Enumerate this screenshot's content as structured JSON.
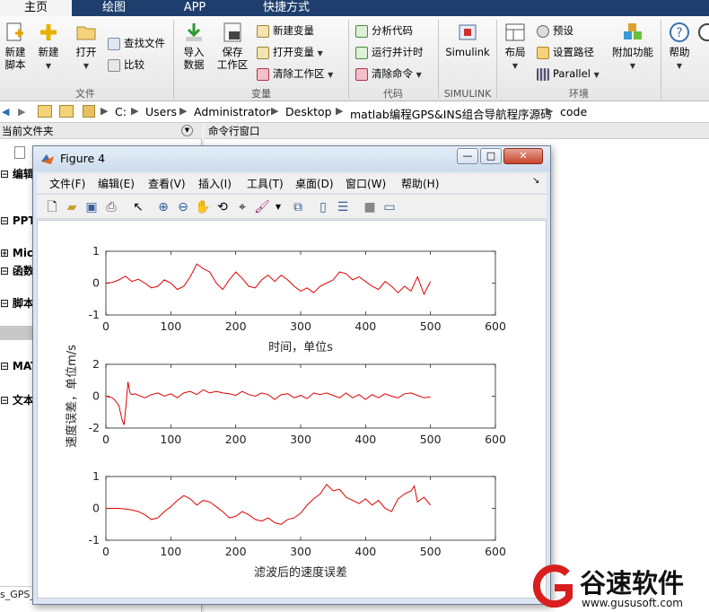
{
  "tabs": [
    "主页",
    "绘图",
    "APP",
    "快捷方式"
  ],
  "ribbon": {
    "file": {
      "new_script": "新建\n脚本",
      "new": "新建",
      "open": "打开",
      "find_files": "查找文件",
      "compare": "比较",
      "label": "文件"
    },
    "variable": {
      "import_data": "导入\n数据",
      "save_workspace": "保存\n工作区",
      "new_variable": "新建变量",
      "open_variable": "打开变量",
      "clear_workspace": "清除工作区",
      "label": "变量"
    },
    "code": {
      "analyze_code": "分析代码",
      "run_and_time": "运行并计时",
      "clear_commands": "清除命令",
      "label": "代码"
    },
    "simulink": {
      "button": "Simulink",
      "label": "SIMULINK"
    },
    "environment": {
      "layout": "布局",
      "preferences": "预设",
      "set_path": "设置路径",
      "parallel": "Parallel",
      "addons": "附加功能",
      "label": "环境"
    },
    "resources": {
      "help": "帮助"
    }
  },
  "address": {
    "path": [
      "C:",
      "Users",
      "Administrator",
      "Desktop",
      "matlab编程GPS&INS组合导航程序源码",
      "code"
    ]
  },
  "panes": {
    "current_folder": "当前文件夹",
    "command_window": "命令行窗口",
    "tree": [
      "编辑",
      "PPT",
      "Micr",
      "函数",
      "脚本",
      "MAT",
      "文本"
    ],
    "status_file": "s_GPS_"
  },
  "figure": {
    "title": "Figure 4",
    "menus": [
      "文件(F)",
      "编辑(E)",
      "查看(V)",
      "插入(I)",
      "工具(T)",
      "桌面(D)",
      "窗口(W)",
      "帮助(H)"
    ]
  },
  "chart_data": [
    {
      "type": "line",
      "title": "",
      "xlabel": "时间，单位s",
      "ylabel": "",
      "xlim": [
        0,
        600
      ],
      "ylim": [
        -1,
        1
      ],
      "xticks": [
        0,
        100,
        200,
        300,
        400,
        500,
        600
      ],
      "yticks": [
        -1,
        0,
        1
      ],
      "series": [
        {
          "color": "#e00000",
          "x": [
            0,
            10,
            20,
            30,
            40,
            50,
            60,
            70,
            80,
            90,
            100,
            110,
            120,
            130,
            140,
            150,
            160,
            170,
            180,
            190,
            200,
            210,
            220,
            230,
            240,
            250,
            260,
            270,
            280,
            290,
            300,
            310,
            320,
            330,
            340,
            350,
            360,
            370,
            380,
            390,
            400,
            410,
            420,
            430,
            440,
            450,
            460,
            470,
            480,
            490,
            500
          ],
          "y": [
            0.0,
            0.02,
            0.1,
            0.22,
            0.05,
            0.12,
            0.0,
            -0.15,
            -0.1,
            0.1,
            0.0,
            -0.2,
            -0.1,
            0.2,
            0.6,
            0.45,
            0.35,
            0.0,
            -0.2,
            0.1,
            0.35,
            0.15,
            -0.1,
            -0.15,
            0.1,
            0.25,
            0.05,
            0.25,
            0.1,
            -0.1,
            -0.25,
            -0.15,
            -0.3,
            -0.1,
            0.0,
            0.1,
            0.35,
            0.3,
            0.1,
            0.2,
            0.05,
            -0.1,
            -0.2,
            0.05,
            -0.1,
            -0.3,
            -0.1,
            -0.25,
            0.2,
            -0.35,
            0.05
          ]
        }
      ]
    },
    {
      "type": "line",
      "title": "",
      "xlabel": "",
      "ylabel": "速度误差，单位m/s",
      "xlim": [
        0,
        600
      ],
      "ylim": [
        -2,
        2
      ],
      "xticks": [
        0,
        100,
        200,
        300,
        400,
        500,
        600
      ],
      "yticks": [
        -2,
        0,
        2
      ],
      "series": [
        {
          "color": "#e00000",
          "x": [
            0,
            5,
            10,
            15,
            20,
            25,
            28,
            31,
            34,
            37,
            40,
            45,
            50,
            60,
            70,
            80,
            90,
            100,
            110,
            120,
            130,
            140,
            150,
            160,
            170,
            180,
            190,
            200,
            210,
            220,
            230,
            240,
            250,
            260,
            270,
            280,
            290,
            300,
            310,
            320,
            330,
            340,
            350,
            360,
            370,
            380,
            390,
            400,
            410,
            420,
            430,
            440,
            450,
            460,
            470,
            480,
            490,
            500
          ],
          "y": [
            0.0,
            -0.05,
            -0.1,
            -0.3,
            -0.6,
            -1.5,
            -1.8,
            -0.6,
            0.9,
            0.2,
            0.1,
            0.15,
            0.05,
            -0.1,
            0.1,
            0.2,
            0.0,
            0.15,
            -0.1,
            0.2,
            0.3,
            0.1,
            0.4,
            0.2,
            0.3,
            0.2,
            0.15,
            0.05,
            0.3,
            0.1,
            0.0,
            0.2,
            0.1,
            -0.2,
            0.1,
            0.15,
            -0.1,
            0.05,
            -0.15,
            0.2,
            0.1,
            0.2,
            0.05,
            -0.1,
            0.2,
            -0.1,
            0.1,
            -0.2,
            0.1,
            -0.1,
            0.15,
            0.0,
            -0.1,
            0.15,
            0.2,
            0.05,
            -0.1,
            -0.05
          ]
        }
      ]
    },
    {
      "type": "line",
      "title": "",
      "xlabel": "滤波后的速度误差",
      "ylabel": "",
      "xlim": [
        0,
        600
      ],
      "ylim": [
        -1,
        1
      ],
      "xticks": [
        0,
        100,
        200,
        300,
        400,
        500,
        600
      ],
      "yticks": [
        -1,
        0,
        1
      ],
      "series": [
        {
          "color": "#e00000",
          "x": [
            0,
            10,
            20,
            30,
            40,
            50,
            60,
            70,
            80,
            90,
            100,
            110,
            120,
            130,
            140,
            150,
            160,
            170,
            180,
            190,
            200,
            210,
            220,
            230,
            240,
            250,
            260,
            270,
            280,
            290,
            300,
            310,
            320,
            330,
            340,
            350,
            360,
            370,
            380,
            390,
            400,
            410,
            420,
            430,
            440,
            450,
            460,
            470,
            475,
            480,
            490,
            500
          ],
          "y": [
            0.0,
            0.0,
            0.0,
            -0.02,
            -0.05,
            -0.1,
            -0.2,
            -0.35,
            -0.3,
            -0.1,
            0.05,
            0.25,
            0.4,
            0.3,
            0.1,
            0.25,
            0.2,
            0.05,
            -0.1,
            -0.3,
            -0.25,
            -0.1,
            -0.2,
            -0.35,
            -0.4,
            -0.3,
            -0.45,
            -0.5,
            -0.35,
            -0.3,
            -0.15,
            0.1,
            0.3,
            0.45,
            0.75,
            0.55,
            0.6,
            0.35,
            0.25,
            0.15,
            0.3,
            0.1,
            0.25,
            0.0,
            -0.1,
            0.3,
            0.45,
            0.55,
            0.7,
            0.2,
            0.35,
            0.1
          ]
        }
      ]
    }
  ],
  "watermark": {
    "brand": "谷速软件",
    "url": "www.gususoft.com"
  },
  "colors": {
    "tabbar": "#1e3f6e",
    "trace": "#e00000",
    "watermark_red": "#d81e1e"
  }
}
